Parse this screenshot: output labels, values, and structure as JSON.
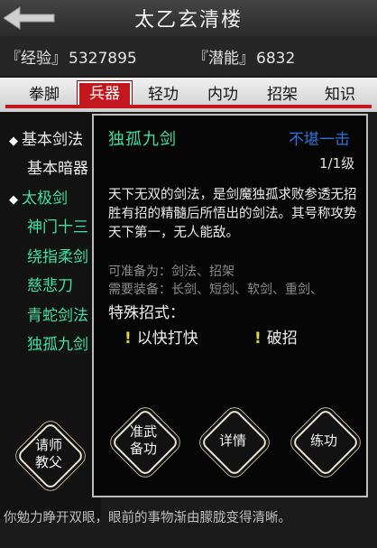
{
  "header": {
    "title": "太乙玄清楼"
  },
  "stats": {
    "exp_label": "『经验』",
    "exp_value": "5327895",
    "pot_label": "『潜能』",
    "pot_value": "6832"
  },
  "tabs": [
    {
      "label": "拳脚"
    },
    {
      "label": "兵器",
      "active": true
    },
    {
      "label": "轻功"
    },
    {
      "label": "内功"
    },
    {
      "label": "招架"
    },
    {
      "label": "知识"
    }
  ],
  "skills": [
    {
      "label": "基本剑法",
      "style": "white",
      "diamond": true
    },
    {
      "label": "基本暗器",
      "style": "white"
    },
    {
      "label": "太极剑",
      "style": "green",
      "diamond": true
    },
    {
      "label": "神门十三",
      "style": "green"
    },
    {
      "label": "绕指柔剑",
      "style": "green"
    },
    {
      "label": "慈悲刀",
      "style": "green"
    },
    {
      "label": "青蛇剑法",
      "style": "green"
    },
    {
      "label": "独孤九剑",
      "style": "green",
      "selected": true
    }
  ],
  "popup": {
    "name": "独孤九剑",
    "tag": "不堪一击",
    "level": "1/1级",
    "desc": "天下无双的剑法，是剑魔独孤求败参透无招胜有招的精髓后所悟出的剑法。其号称攻势天下第一，无人能敌。",
    "prep": "可准备为：剑法、招架",
    "equip": "需要装备：长剑、短剑、软剑、重剑、",
    "special_title": "特殊招式：",
    "moves": [
      "以快打快",
      "破招"
    ]
  },
  "buttons": {
    "master": "请师\n教父",
    "prepare": "准武\n备功",
    "details": "详情",
    "practice": "练功"
  },
  "footer": {
    "text": "你勉力睁开双眼，眼前的事物渐由朦胧变得清晰。"
  },
  "colors": {
    "accent": "#c4171d",
    "skill_green": "#3de1a4",
    "tag_blue": "#2f73d8"
  }
}
